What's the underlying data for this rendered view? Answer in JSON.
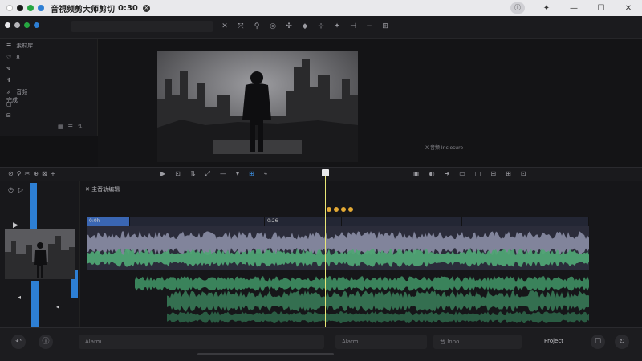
{
  "window": {
    "title": "音視频剪大师剪切",
    "title_time": "0:30",
    "close_glyph": "×",
    "traffic_colors": [
      "#e9e9ec",
      "#1a1a1a",
      "#26a641",
      "#2d7fd4"
    ],
    "right_icons": [
      "info-icon",
      "extension-icon",
      "minimize-icon",
      "maximize-icon",
      "close-icon"
    ],
    "right_glyphs": [
      "ⓘ",
      "✦",
      "—",
      "☐",
      "✕"
    ]
  },
  "toolbar": {
    "icons": [
      "close-icon",
      "transform-icon",
      "speed-icon",
      "audio-icon",
      "crop-icon",
      "filter-icon",
      "stabilize-icon",
      "magic-icon",
      "minus-icon",
      "plus-icon",
      "settings-icon"
    ],
    "glyphs": [
      "✕",
      "⤧",
      "⚲",
      "◎",
      "✣",
      "◆",
      "⊹",
      "✦",
      "⊣",
      "−",
      "⊞"
    ]
  },
  "sidebar": {
    "header": "素材库",
    "rows": [
      {
        "icon": "♡",
        "label": "8"
      },
      {
        "icon": "✎",
        "label": ""
      },
      {
        "icon": "♆",
        "label": ""
      },
      {
        "icon": "⇗",
        "label": "音频\n完成"
      },
      {
        "icon": "▢",
        "label": ""
      },
      {
        "icon": "⊟",
        "label": ""
      }
    ]
  },
  "viewer": {
    "label": "X 音频 Inclosure"
  },
  "timeline_toolbar": {
    "left_tools": [
      "⊘",
      "⚲",
      "✂",
      "⊕",
      "⊠",
      "+"
    ],
    "mid_tools": [
      "▶",
      "⊡",
      "⇅",
      "⤢",
      "—",
      "▾",
      "⊞",
      "⌁"
    ],
    "right_tools": [
      "▣",
      "◐",
      "➜",
      "▭",
      "▢",
      "⊟",
      "⊞",
      "⊡"
    ]
  },
  "timeline": {
    "sequence_label": "主音轨编辑",
    "clip_segments": [
      "0:0h",
      "",
      "",
      "0:26",
      "",
      ""
    ],
    "track_glyphs": [
      "◷",
      "▷",
      "▶",
      "◂",
      "◂"
    ]
  },
  "bottombar": {
    "undo_glyph": "↶",
    "info_glyph": "ⓘ",
    "field1": "Alarm",
    "field2": "Alarm",
    "field3": "音 Inno",
    "action": "Project",
    "round_glyph1": "☐",
    "round_glyph2": "↻"
  }
}
